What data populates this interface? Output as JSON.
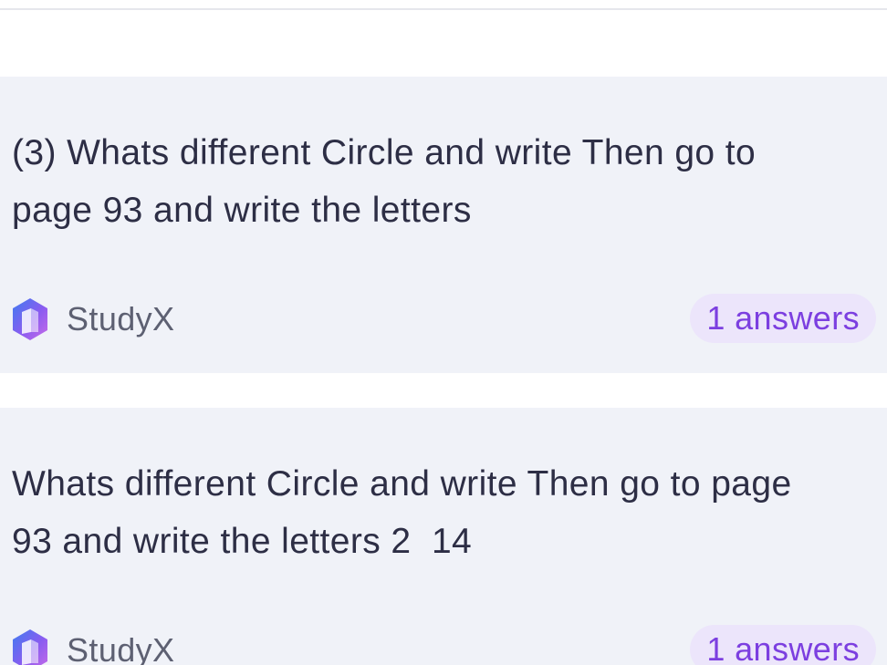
{
  "cards": [
    {
      "question": "(3) Whats different Circle and write Then go to\npage 93 and write the letters",
      "source": "StudyX",
      "answers_label": "1 answers"
    },
    {
      "question": "Whats different Circle and write Then go to page\n93 and write the letters 2  14",
      "source": "StudyX",
      "answers_label": "1 answers"
    }
  ],
  "icons": {
    "brand_logo": "studyx-logo-icon"
  },
  "colors": {
    "card_background": "#f0f2f8",
    "question_text": "#2d2e45",
    "brand_text": "#5d6072",
    "accent_purple": "#7c3fe0",
    "pill_background": "#ece5fb"
  }
}
